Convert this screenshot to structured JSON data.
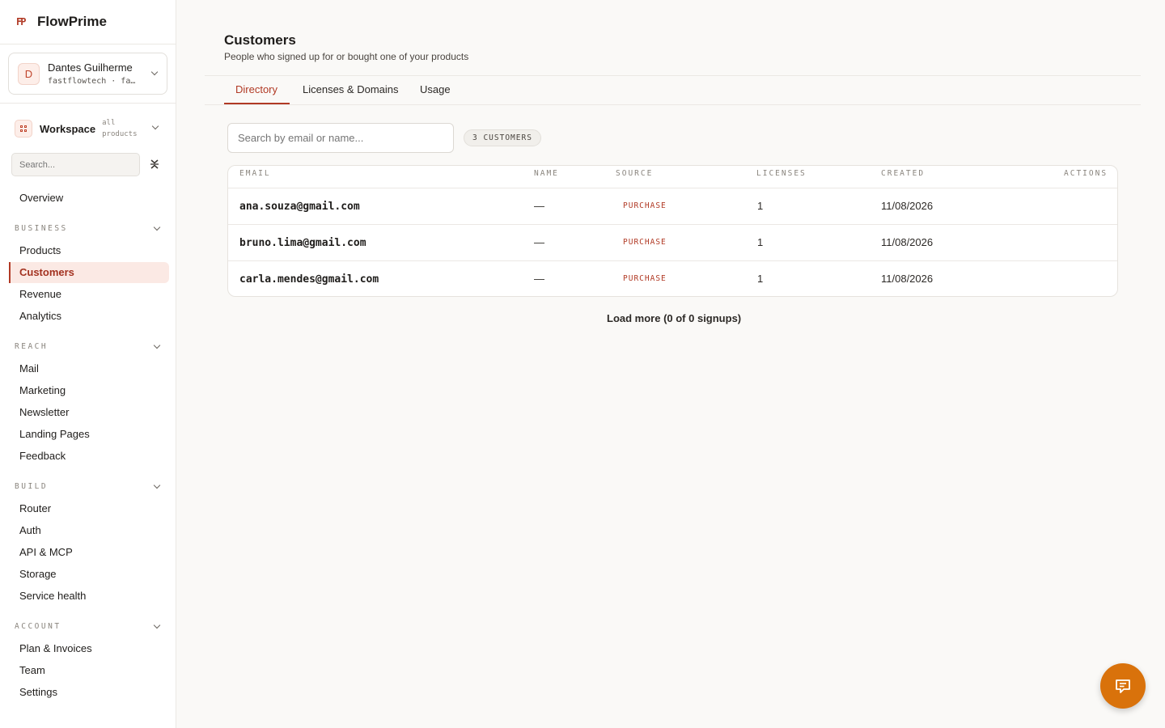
{
  "app": {
    "brand_logo": "FP",
    "brand_name": "FlowPrime"
  },
  "account": {
    "initial": "D",
    "name": "Dantes Guilherme",
    "subline": "fastflowtech · fa…"
  },
  "workspace": {
    "label": "Workspace",
    "sub": "all products"
  },
  "sidebar": {
    "search_placeholder": "Search...",
    "overview": "Overview",
    "sections": [
      {
        "label": "BUSINESS",
        "items": [
          "Products",
          "Customers",
          "Revenue",
          "Analytics"
        ]
      },
      {
        "label": "REACH",
        "items": [
          "Mail",
          "Marketing",
          "Newsletter",
          "Landing Pages",
          "Feedback"
        ]
      },
      {
        "label": "BUILD",
        "items": [
          "Router",
          "Auth",
          "API & MCP",
          "Storage",
          "Service health"
        ]
      },
      {
        "label": "ACCOUNT",
        "items": [
          "Plan & Invoices",
          "Team",
          "Settings"
        ]
      }
    ],
    "active_item": "Customers"
  },
  "page": {
    "title": "Customers",
    "subtitle": "People who signed up for or bought one of your products"
  },
  "tabs": [
    {
      "label": "Directory",
      "active": true
    },
    {
      "label": "Licenses & Domains",
      "active": false
    },
    {
      "label": "Usage",
      "active": false
    }
  ],
  "search": {
    "placeholder": "Search by email or name..."
  },
  "count_badge": "3 CUSTOMERS",
  "table": {
    "headers": {
      "email": "EMAIL",
      "name": "NAME",
      "source": "SOURCE",
      "licenses": "LICENSES",
      "created": "CREATED",
      "actions": "ACTIONS"
    },
    "rows": [
      {
        "email": "ana.souza@gmail.com",
        "name": "—",
        "source": "PURCHASE",
        "licenses": "1",
        "created": "11/08/2026"
      },
      {
        "email": "bruno.lima@gmail.com",
        "name": "—",
        "source": "PURCHASE",
        "licenses": "1",
        "created": "11/08/2026"
      },
      {
        "email": "carla.mendes@gmail.com",
        "name": "—",
        "source": "PURCHASE",
        "licenses": "1",
        "created": "11/08/2026"
      }
    ]
  },
  "load_more": "Load more (0 of 0 signups)",
  "colors": {
    "accent": "#b13a25",
    "fab": "#d9720b",
    "active_bg": "#fbe9e4"
  },
  "icons": {
    "chat": "chat-bubble-icon",
    "collapse": "collapse-icon",
    "workspace": "grid-icon"
  }
}
